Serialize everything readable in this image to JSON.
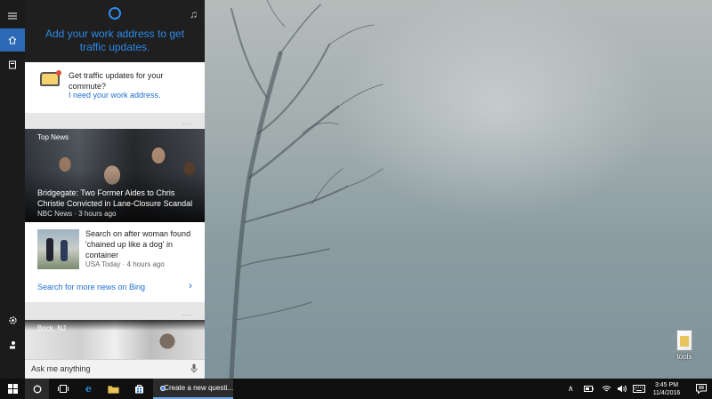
{
  "cortana": {
    "header_title": "Add your work address to get traffic updates.",
    "traffic_card": {
      "text": "Get traffic updates for your commute?",
      "link": "I need your work address."
    },
    "news": {
      "hero_tag": "Top News",
      "hero_headline": "Bridgegate: Two Former Aides to Chris Christie Convicted in Lane-Closure Scandal",
      "hero_source": "NBC News · 3 hours ago",
      "article_title": "Search on after woman found 'chained up like a dog' in container",
      "article_source": "USA Today · 4 hours ago",
      "search_more": "Search for more news on Bing",
      "card2_tag": "Brick, NJ"
    },
    "dots": "...",
    "ask_placeholder": "Ask me anything"
  },
  "desktop": {
    "icon_label": "tools"
  },
  "taskbar": {
    "chrome_title": "Create a new questi...",
    "time": "3:45 PM",
    "date": "11/4/2016"
  },
  "icons": {
    "hamburger": "hamburger-menu-icon",
    "home": "home-icon",
    "notebook": "notebook-icon",
    "settings": "settings-icon",
    "feedback": "feedback-icon",
    "cortana": "cortana-ring-icon",
    "music": "music-note-icon",
    "mic": "microphone-icon"
  },
  "colors": {
    "accent": "#2b69b7",
    "link": "#1f6fd1",
    "cortana_blue": "#2e8ff0"
  }
}
